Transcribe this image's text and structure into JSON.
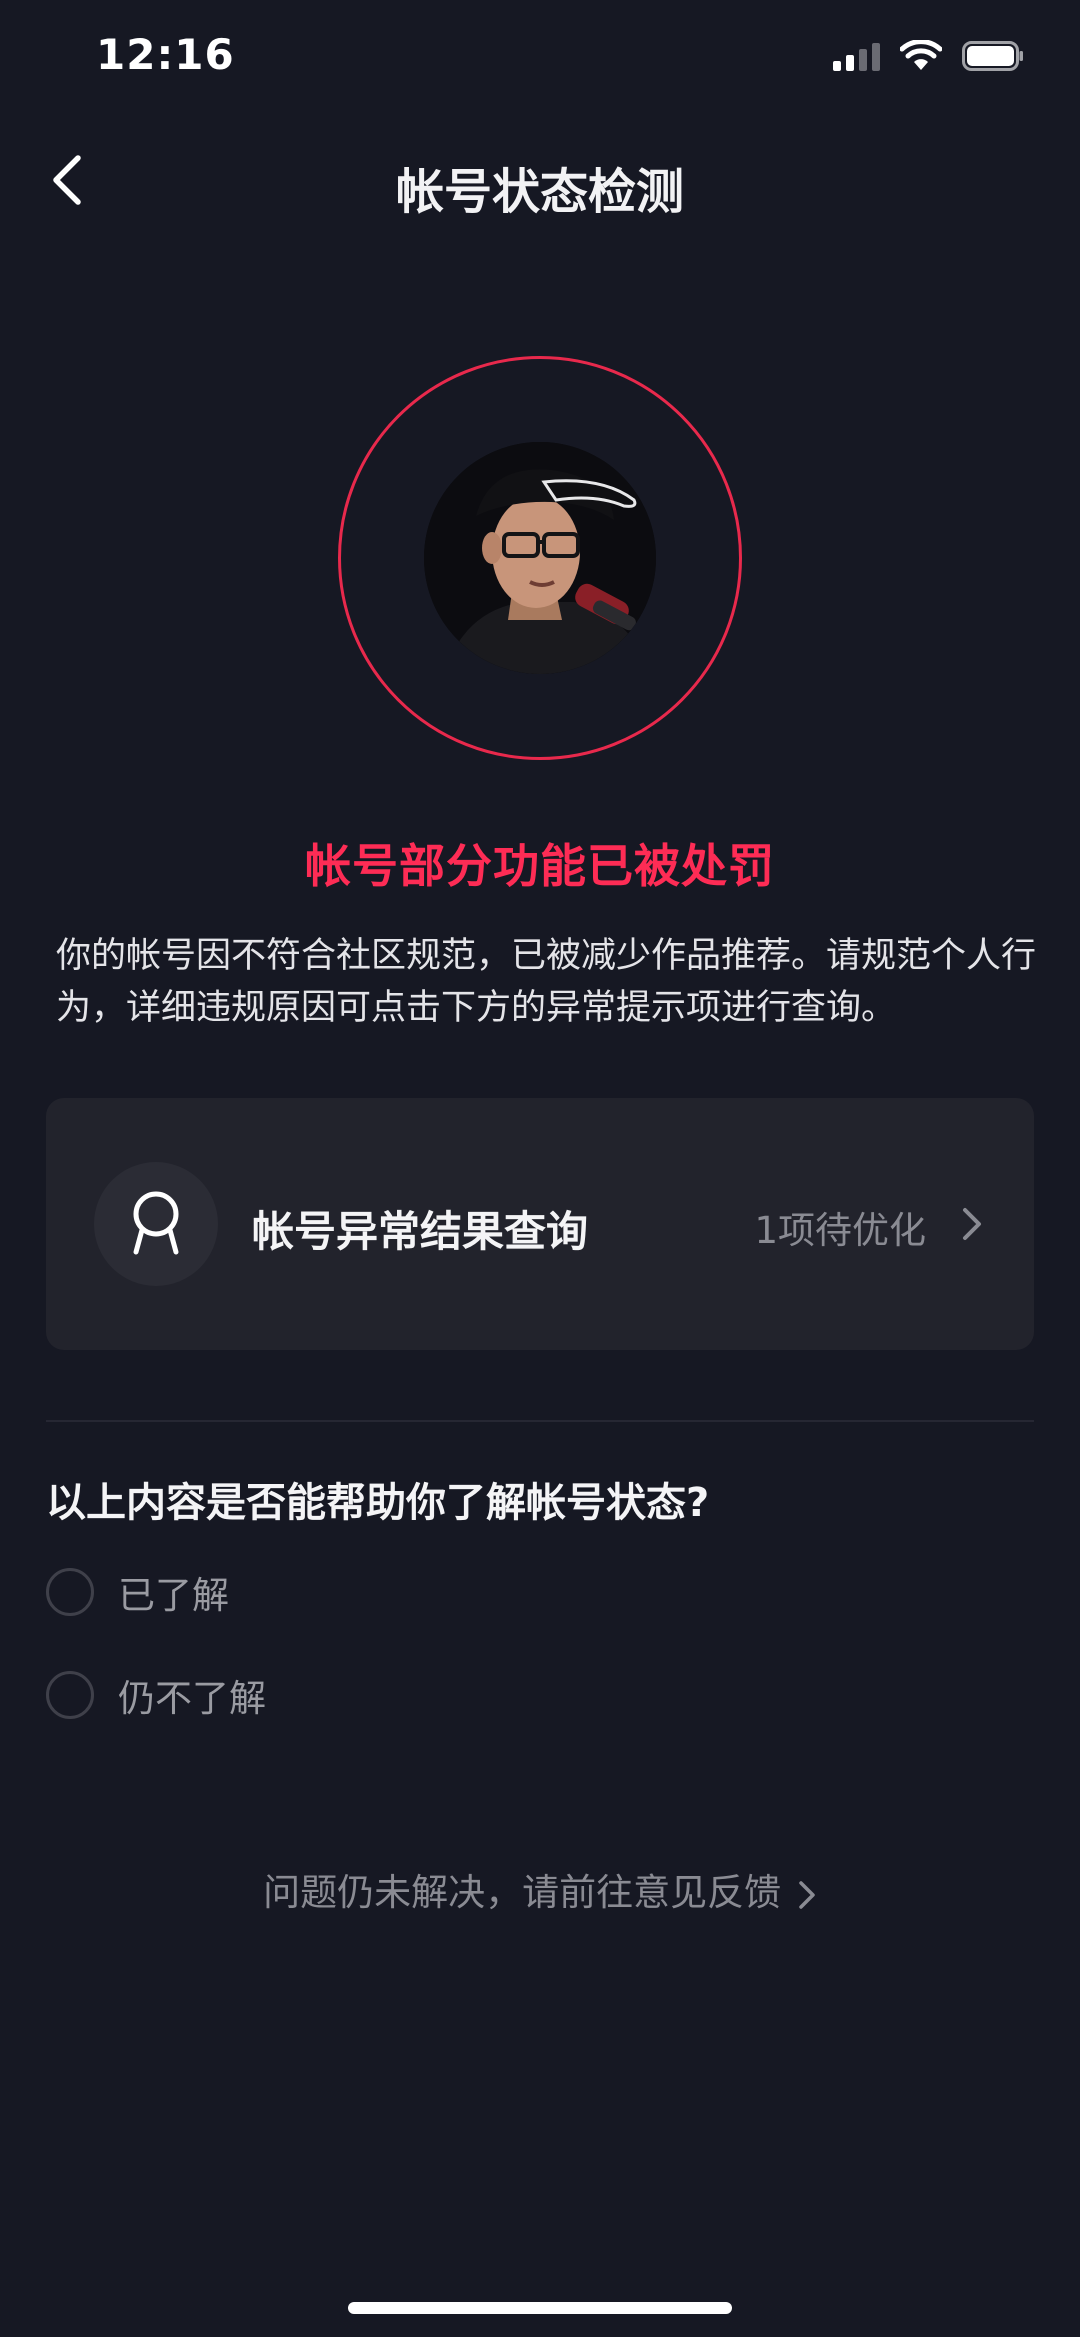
{
  "status_bar": {
    "time": "12:16"
  },
  "header": {
    "title": "帐号状态检测",
    "back_icon": "chevron-left-icon"
  },
  "avatar": {
    "ring_color": "#e8294c"
  },
  "penalty": {
    "title": "帐号部分功能已被处罚",
    "description": "你的帐号因不符合社区规范，已被减少作品推荐。请规范个人行为，详细违规原因可点击下方的异常提示项进行查询。",
    "accent_color": "#fe2c55"
  },
  "result_card": {
    "icon": "user-badge-icon",
    "title": "帐号异常结果查询",
    "status": "1项待优化"
  },
  "survey": {
    "question": "以上内容是否能帮助你了解帐号状态?",
    "options": [
      {
        "label": "已了解",
        "selected": false
      },
      {
        "label": "仍不了解",
        "selected": false
      }
    ]
  },
  "feedback": {
    "text": "问题仍未解决，请前往意见反馈"
  },
  "colors": {
    "background": "#161823",
    "card": "#22232c"
  }
}
